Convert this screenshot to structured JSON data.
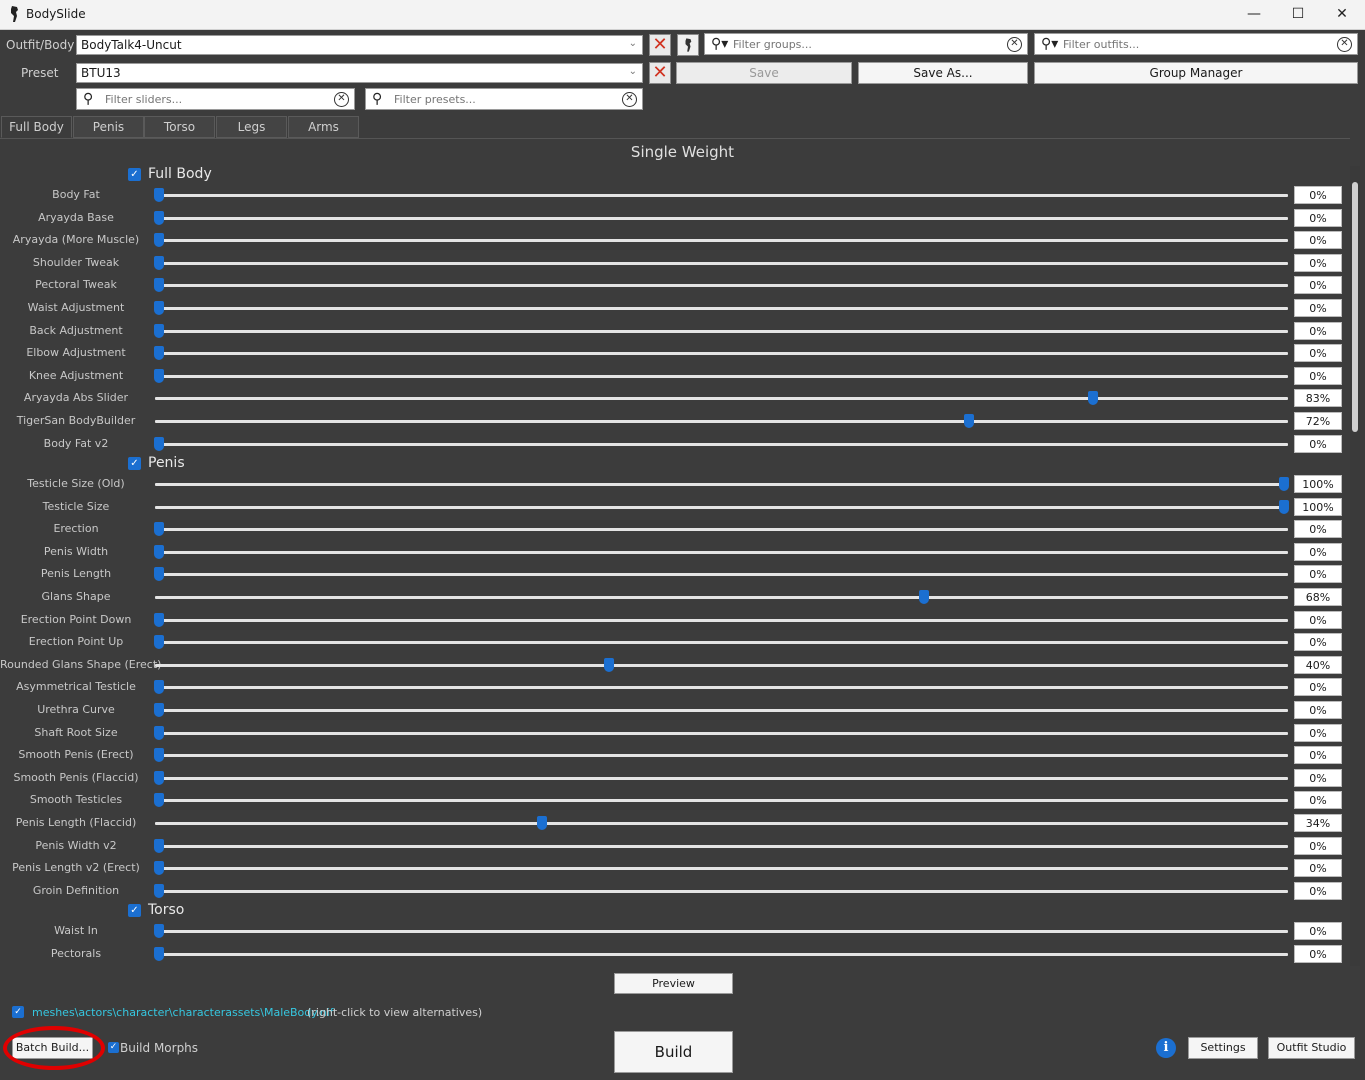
{
  "window": {
    "title": "BodySlide",
    "minimize": "—",
    "maximize": "☐",
    "close": "✕"
  },
  "outfit": {
    "label": "Outfit/Body",
    "value": "BodyTalk4-Uncut"
  },
  "preset": {
    "label": "Preset",
    "value": "BTU13"
  },
  "filters": {
    "groups_placeholder": "Filter groups...",
    "outfits_placeholder": "Filter outfits...",
    "sliders_placeholder": "Filter sliders...",
    "presets_placeholder": "Filter presets..."
  },
  "buttons": {
    "save": "Save",
    "save_as": "Save As...",
    "group_manager": "Group Manager",
    "preview": "Preview",
    "build": "Build",
    "batch_build": "Batch Build...",
    "settings": "Settings",
    "outfit_studio": "Outfit Studio"
  },
  "tabs": [
    "Full Body",
    "Penis",
    "Torso",
    "Legs",
    "Arms"
  ],
  "heading": "Single Weight",
  "groups": [
    {
      "name": "Full Body",
      "sliders": [
        {
          "name": "Body Fat",
          "value": 0
        },
        {
          "name": "Aryayda Base",
          "value": 0
        },
        {
          "name": "Aryayda (More Muscle)",
          "value": 0
        },
        {
          "name": "Shoulder Tweak",
          "value": 0
        },
        {
          "name": "Pectoral Tweak",
          "value": 0
        },
        {
          "name": "Waist Adjustment",
          "value": 0
        },
        {
          "name": "Back Adjustment",
          "value": 0
        },
        {
          "name": "Elbow Adjustment",
          "value": 0
        },
        {
          "name": "Knee Adjustment",
          "value": 0
        },
        {
          "name": "Aryayda Abs Slider",
          "value": 83
        },
        {
          "name": "TigerSan BodyBuilder",
          "value": 72
        },
        {
          "name": "Body Fat v2",
          "value": 0
        }
      ]
    },
    {
      "name": "Penis",
      "sliders": [
        {
          "name": "Testicle Size (Old)",
          "value": 100
        },
        {
          "name": "Testicle Size",
          "value": 100
        },
        {
          "name": "Erection",
          "value": 0
        },
        {
          "name": "Penis Width",
          "value": 0
        },
        {
          "name": "Penis Length",
          "value": 0
        },
        {
          "name": "Glans Shape",
          "value": 68
        },
        {
          "name": "Erection Point Down",
          "value": 0
        },
        {
          "name": "Erection Point Up",
          "value": 0
        },
        {
          "name": "Rounded Glans Shape (Erect)",
          "value": 40
        },
        {
          "name": "Asymmetrical Testicle",
          "value": 0
        },
        {
          "name": "Urethra Curve",
          "value": 0
        },
        {
          "name": "Shaft Root Size",
          "value": 0
        },
        {
          "name": "Smooth Penis (Erect)",
          "value": 0
        },
        {
          "name": "Smooth Penis (Flaccid)",
          "value": 0
        },
        {
          "name": "Smooth Testicles",
          "value": 0
        },
        {
          "name": "Penis Length (Flaccid)",
          "value": 34
        },
        {
          "name": "Penis Width v2",
          "value": 0
        },
        {
          "name": "Penis Length v2 (Erect)",
          "value": 0
        },
        {
          "name": "Groin Definition",
          "value": 0
        }
      ]
    },
    {
      "name": "Torso",
      "sliders": [
        {
          "name": "Waist In",
          "value": 0
        },
        {
          "name": "Pectorals",
          "value": 0
        }
      ]
    }
  ],
  "output": {
    "path": "meshes\\actors\\character\\characterassets\\MaleBody.nif",
    "note": "(right-click to view alternatives)"
  },
  "build_morphs": "Build Morphs",
  "colors": {
    "accent": "#1b6fd1",
    "path_text": "#36c7e0",
    "highlight_ring": "#e00000",
    "background": "#3c3c3c"
  }
}
